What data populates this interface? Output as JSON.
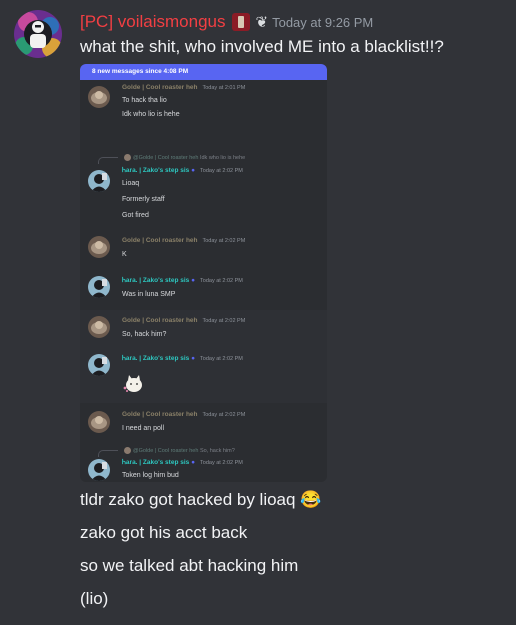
{
  "message": {
    "author": "[PC] voilaismongus",
    "timestamp": "Today at 9:26 PM",
    "text": "what the shit, who involved ME into a blacklist!!?",
    "lines_after": [
      "tldr zako got hacked by lioaq 😂",
      "zako got his acct back",
      "so we talked abt hacking him",
      "(lio)"
    ]
  },
  "embed": {
    "banner": "8 new messages since 4:08 PM",
    "messages": [
      {
        "author": "Golde | Cool roaster heh",
        "time": "Today at 2:01 PM",
        "lines": [
          "To hack tha lio",
          "Idk who lio is hehe"
        ]
      },
      {
        "reply_author": "@Golde | Cool roaster heh",
        "reply_text": "Idk who lio is hehe",
        "author": "Ꮒara. | Zako's step sis",
        "time": "Today at 2:02 PM",
        "lines": [
          "Lioaq",
          "Formerly staff",
          "Got fired"
        ]
      },
      {
        "author": "Golde | Cool roaster heh",
        "time": "Today at 2:02 PM",
        "lines": [
          "K"
        ]
      },
      {
        "author": "Ꮒara. | Zako's step sis",
        "time": "Today at 2:02 PM",
        "lines": [
          "Was in luna SMP"
        ]
      },
      {
        "author": "Golde | Cool roaster heh",
        "time": "Today at 2:02 PM",
        "lines": [
          "So, hack him?"
        ]
      },
      {
        "author": "Ꮒara. | Zako's step sis",
        "time": "Today at 2:02 PM",
        "lines": []
      },
      {
        "author": "Golde | Cool roaster heh",
        "time": "Today at 2:02 PM",
        "lines": [
          "I need an poll"
        ]
      },
      {
        "reply_author": "@Golde | Cool roaster heh",
        "reply_text": "So, hack him?",
        "author": "Ꮒara. | Zako's step sis",
        "time": "Today at 2:02 PM",
        "lines": [
          "Token log him bud"
        ]
      }
    ]
  },
  "colors": {
    "background": "#313338",
    "author": "#f23f43",
    "embed_bg": "#2b2d31",
    "banner": "#5865f2",
    "golde_name": "#8a8068",
    "zako_name": "#2dc7c0"
  }
}
